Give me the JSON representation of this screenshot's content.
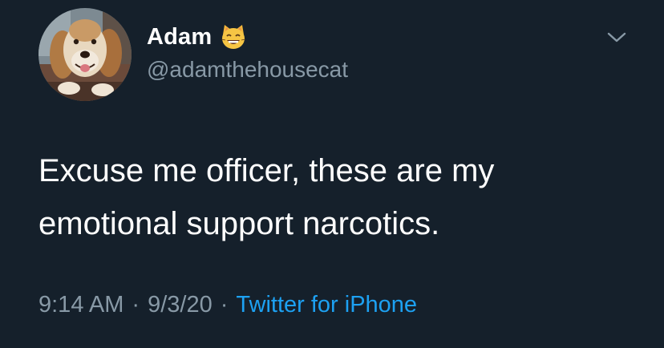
{
  "author": {
    "display_name": "Adam",
    "name_emoji": "grinning-cat-emoji",
    "handle": "@adamthehousecat",
    "avatar": "dog-photo-avatar"
  },
  "tweet": {
    "text_lines": [
      "Excuse me officer, these are my",
      "emotional support narcotics."
    ]
  },
  "meta": {
    "time": "9:14 AM",
    "separator": "·",
    "date": "9/3/20",
    "source": "Twitter for iPhone"
  },
  "icons": {
    "menu": "chevron-down-icon"
  },
  "colors": {
    "background": "#15202b",
    "primary_text": "#ffffff",
    "secondary_text": "#8899a6",
    "link": "#1da1f2"
  }
}
